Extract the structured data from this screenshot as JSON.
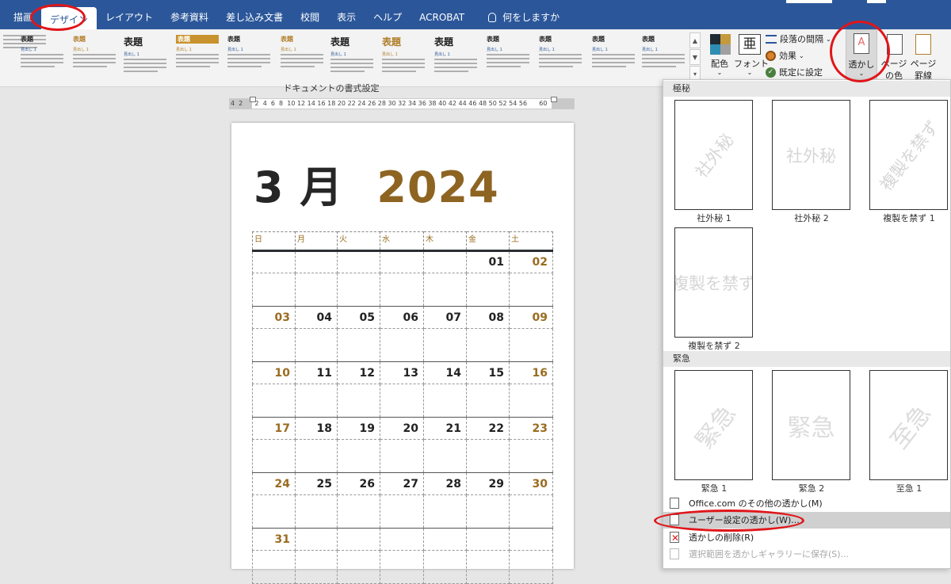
{
  "ribbon_tabs": [
    "描画",
    "デザイン",
    "レイアウト",
    "参考資料",
    "差し込み文書",
    "校閲",
    "表示",
    "ヘルプ",
    "ACROBAT"
  ],
  "active_tab": "デザイン",
  "tell_me": "何をしますか",
  "style_gallery": [
    {
      "title": "",
      "heading": ""
    },
    {
      "title": "表題",
      "heading": "見出し 1"
    },
    {
      "title": "表題",
      "heading": "見出し 1"
    },
    {
      "title": "表題",
      "heading": "見出し 1"
    },
    {
      "title": "表題",
      "heading": "見出し 1"
    },
    {
      "title": "表題",
      "heading": "見出し 1"
    },
    {
      "title": "表題",
      "heading": "見出し 1"
    },
    {
      "title": "表題",
      "heading": "見出し 1"
    },
    {
      "title": "表題",
      "heading": "見出し 1"
    },
    {
      "title": "表題",
      "heading": "見出し 1"
    },
    {
      "title": "表題",
      "heading": "見出し 1"
    },
    {
      "title": "表題",
      "heading": "見出し 1"
    },
    {
      "title": "表題",
      "heading": "見出し 1"
    },
    {
      "title": "表題",
      "heading": "見出し 1"
    }
  ],
  "ribbon": {
    "colors": "配色",
    "fonts": "フォント",
    "font_icon": "亜",
    "paragraph_spacing": "段落の間隔",
    "effects": "効果",
    "set_default": "既定に設定",
    "watermark": "透かし",
    "page_color_1": "ページ",
    "page_color_2": "の色",
    "page_borders_1": "ページ",
    "page_borders_2": "罫線",
    "group_label": "ドキュメントの書式設定",
    "colors_palette": [
      "#1f2a33",
      "#c49a3e",
      "#2e8db3",
      "#a0a0a0"
    ]
  },
  "ruler": "4  2      2  4  6  8  10 12 14 16 18 20 22 24 26 28 30 32 34 36 38 40 42 44 46 48 50 52 54 56      60",
  "calendar": {
    "month": "3 月",
    "year": "2024",
    "weekdays": [
      "日",
      "月",
      "火",
      "水",
      "木",
      "金",
      "土"
    ],
    "weeks": [
      [
        "",
        "",
        "",
        "",
        "",
        "01",
        "02"
      ],
      [
        "03",
        "04",
        "05",
        "06",
        "07",
        "08",
        "09"
      ],
      [
        "10",
        "11",
        "12",
        "13",
        "14",
        "15",
        "16"
      ],
      [
        "17",
        "18",
        "19",
        "20",
        "21",
        "22",
        "23"
      ],
      [
        "24",
        "25",
        "26",
        "27",
        "28",
        "29",
        "30"
      ],
      [
        "31",
        "",
        "",
        "",
        "",
        "",
        ""
      ]
    ],
    "accent": "#9a6c20"
  },
  "watermark_menu": {
    "section_confidential": "極秘",
    "section_urgent": "緊急",
    "confidential_items": [
      {
        "text": "社外秘",
        "caption": "社外秘 1",
        "style": "diagonal"
      },
      {
        "text": "社外秘",
        "caption": "社外秘 2",
        "style": "horizontal"
      },
      {
        "text": "複製を禁ず",
        "caption": "複製を禁ず 1",
        "style": "diagonal"
      },
      {
        "text": "複製を禁ず",
        "caption": "複製を禁ず 2",
        "style": "horizontal"
      }
    ],
    "urgent_items": [
      {
        "text": "緊急",
        "caption": "緊急 1",
        "style": "diagonal"
      },
      {
        "text": "緊急",
        "caption": "緊急 2",
        "style": "horizontal"
      },
      {
        "text": "至急",
        "caption": "至急 1",
        "style": "diagonal"
      }
    ],
    "commands": [
      {
        "label": "Office.com のその他の透かし(M)",
        "state": "normal",
        "icon": "office-watermark-icon"
      },
      {
        "label": "ユーザー設定の透かし(W)...",
        "state": "highlighted",
        "icon": "custom-watermark-icon"
      },
      {
        "label": "透かしの削除(R)",
        "state": "normal",
        "icon": "remove-watermark-icon"
      },
      {
        "label": "選択範囲を透かしギャラリーに保存(S)...",
        "state": "disabled",
        "icon": "save-watermark-icon"
      }
    ]
  },
  "annotation_color": "#e0161a"
}
